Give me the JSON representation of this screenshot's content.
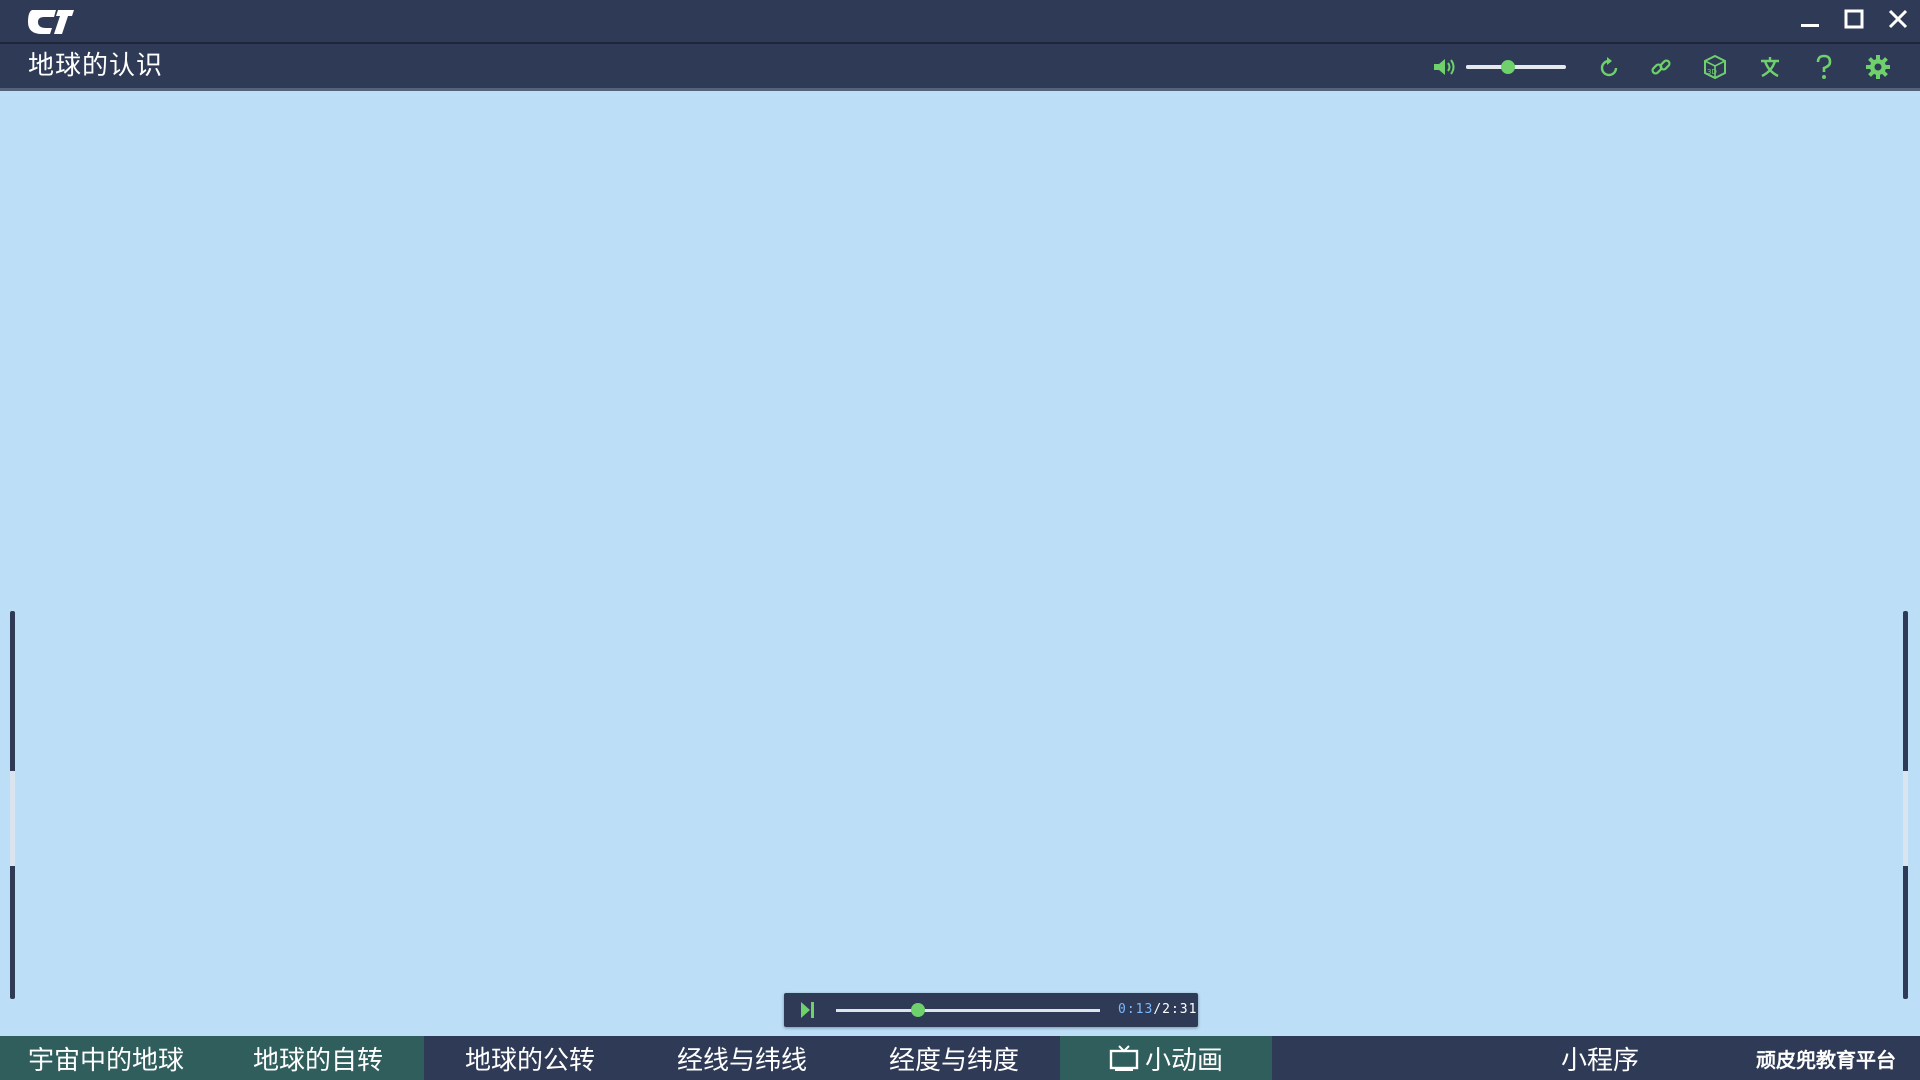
{
  "app": {
    "logo_icon": "app-logo-icon"
  },
  "window_controls": {
    "minimize_icon": "minimize-icon",
    "maximize_icon": "maximize-icon",
    "close_icon": "close-icon"
  },
  "header": {
    "title": "地球的认识",
    "toolbar": [
      {
        "name": "volume-icon"
      },
      {
        "name": "refresh-icon"
      },
      {
        "name": "link-icon"
      },
      {
        "name": "3d-box-icon"
      },
      {
        "name": "text-icon"
      },
      {
        "name": "help-icon"
      },
      {
        "name": "settings-icon"
      }
    ],
    "volume_level": 0.42,
    "accent_color": "#6fd16c"
  },
  "player": {
    "current_time": "0:13",
    "separator": "/",
    "total_time": "2:31",
    "progress": 0.31
  },
  "bottom_nav": {
    "tabs": [
      {
        "label": "宇宙中的地球",
        "active": true
      },
      {
        "label": "地球的自转",
        "active": true
      },
      {
        "label": "地球的公转",
        "active": false
      },
      {
        "label": "经线与纬线",
        "active": false
      },
      {
        "label": "经度与纬度",
        "active": false
      },
      {
        "label": "小动画",
        "active": true,
        "icon": "tv-icon"
      }
    ],
    "program_label": "小程序",
    "brand": "顽皮兜教育平台"
  },
  "colors": {
    "background": "#bcdff7",
    "bar": "#2f3b56",
    "active_tab": "#2f5e5c",
    "accent": "#6fd16c"
  }
}
